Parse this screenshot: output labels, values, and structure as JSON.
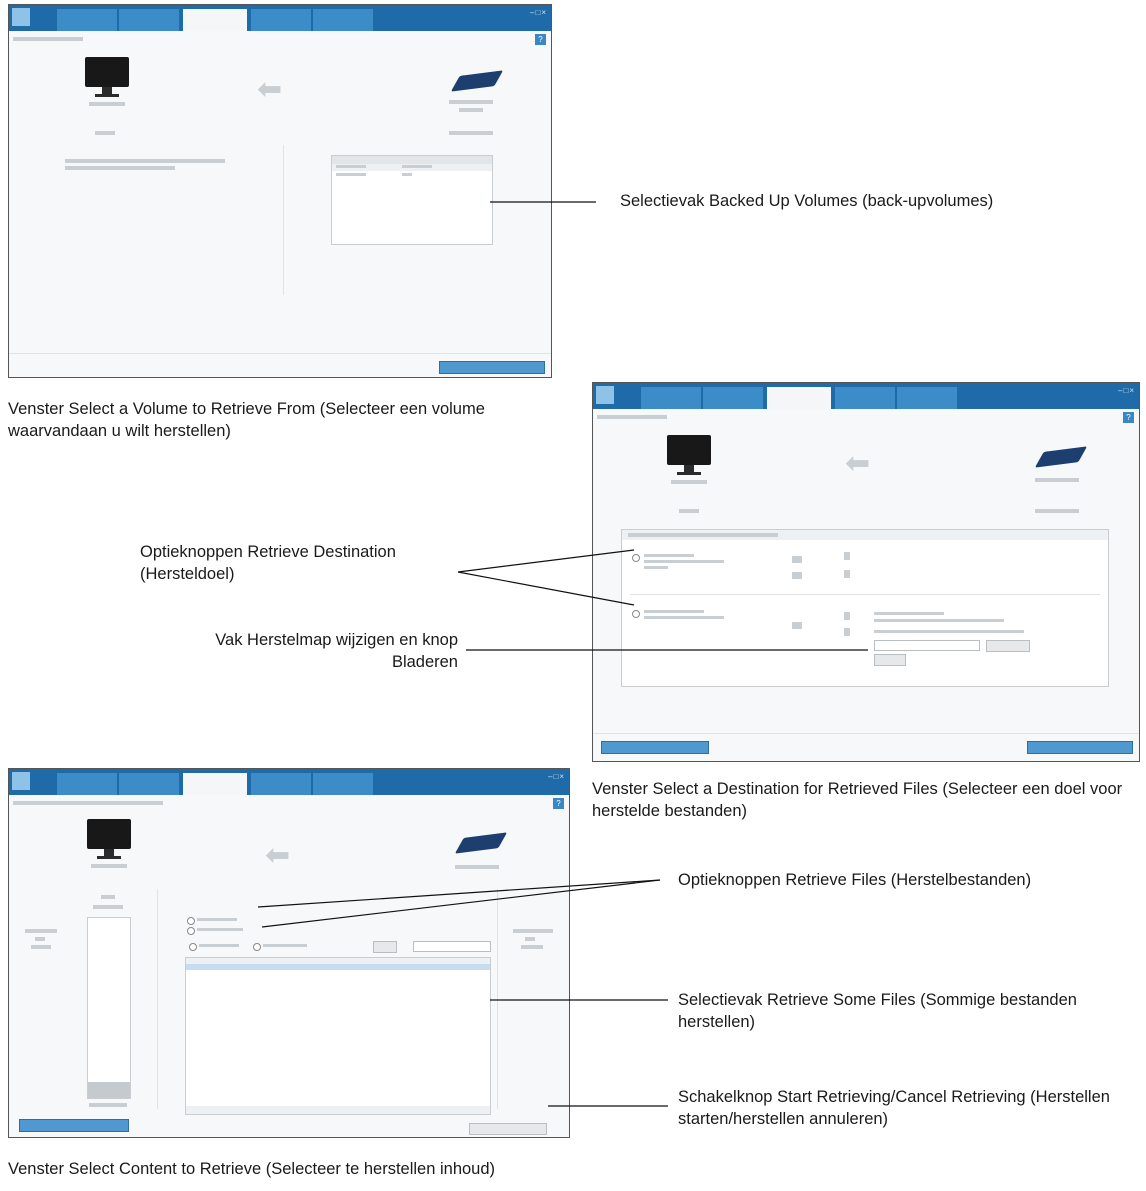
{
  "captions": {
    "caption_1": "Venster Select a Volume to Retrieve From (Selecteer een volume waarvandaan u wilt herstellen)",
    "caption_2": "Venster Select a Destination for Retrieved Files (Selecteer een doel voor herstelde bestanden)",
    "caption_3": "Venster Select Content to Retrieve (Selecteer te herstellen inhoud)"
  },
  "callouts": {
    "backed_up_volumes": "Selectievak Backed Up Volumes (back-upvolumes)",
    "retrieve_destination": "Optieknoppen Retrieve Destination (Hersteldoel)",
    "change_folder": "Vak Herstelmap wijzigen en knop Bladeren",
    "retrieve_files_options": "Optieknoppen Retrieve Files (Herstelbestanden)",
    "retrieve_some_files": "Selectievak Retrieve Some Files (Sommige bestanden herstellen)",
    "start_cancel_toggle": "Schakelknop Start Retrieving/Cancel Retrieving (Herstellen starten/herstellen annuleren)"
  },
  "ui": {
    "help_glyph": "?",
    "window_controls": "–□×",
    "arrow_glyph": "⬅",
    "accent": "#1f6aa8",
    "tab_color": "#3c8cc7",
    "button_color": "#4f98d0"
  },
  "icons": [
    "computer-monitor-icon",
    "external-drive-icon",
    "left-arrow-icon",
    "help-icon"
  ]
}
